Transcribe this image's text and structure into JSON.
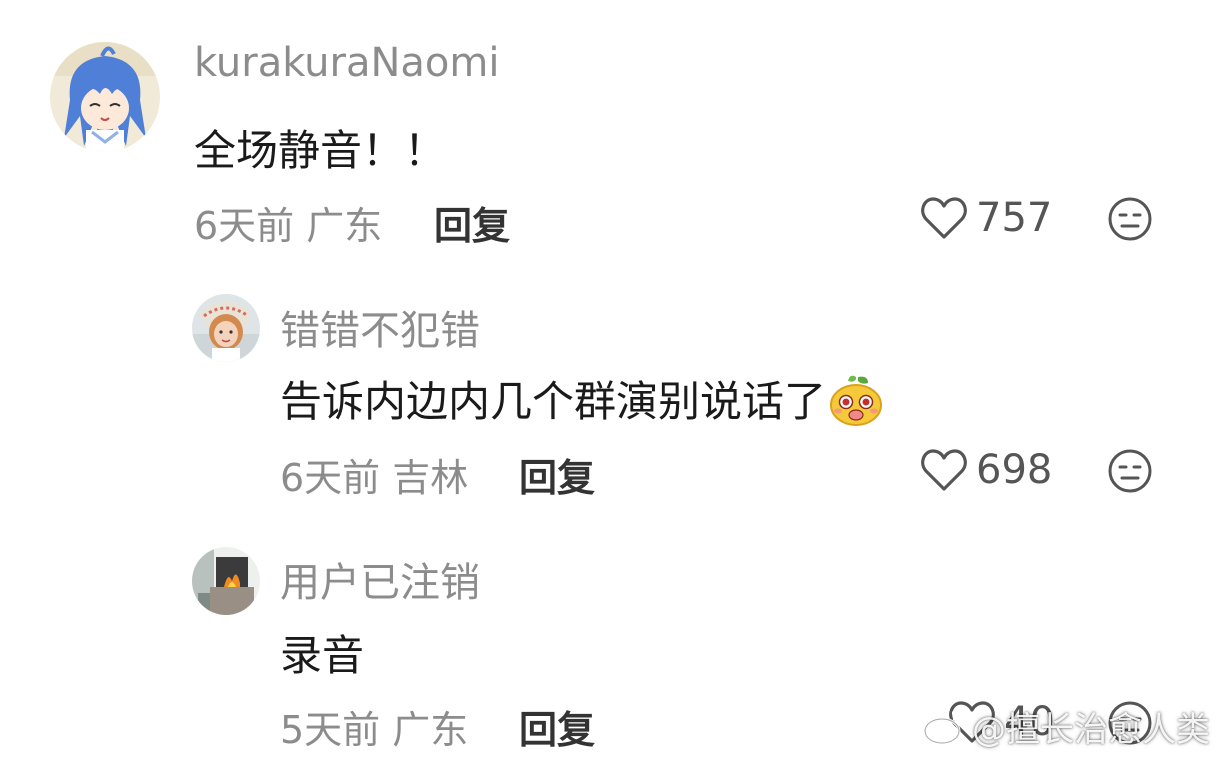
{
  "comments": [
    {
      "username": "kurakuraNaomi",
      "content": "全场静音！！",
      "time": "6天前",
      "location": "广东",
      "reply_label": "回复",
      "likes": "757",
      "avatar_icon": "anime-character-avatar"
    },
    {
      "username": "错错不犯错",
      "content": "告诉内边内几个群演别说话了",
      "time": "6天前",
      "location": "吉林",
      "reply_label": "回复",
      "likes": "698",
      "avatar_icon": "child-photo-avatar",
      "inline_emoji": "yellow-mascot-emoji"
    },
    {
      "username": "用户已注销",
      "content": "录音",
      "time": "5天前",
      "location": "广东",
      "reply_label": "回复",
      "likes": "40",
      "avatar_icon": "fireplace-photo-avatar"
    }
  ],
  "watermark": {
    "text": "@擅长治愈人类",
    "icon": "weibo-logo-icon"
  },
  "colors": {
    "meta_gray": "#8c8c8c",
    "text_dark": "#1a1a1a",
    "icon_gray": "#555555"
  }
}
